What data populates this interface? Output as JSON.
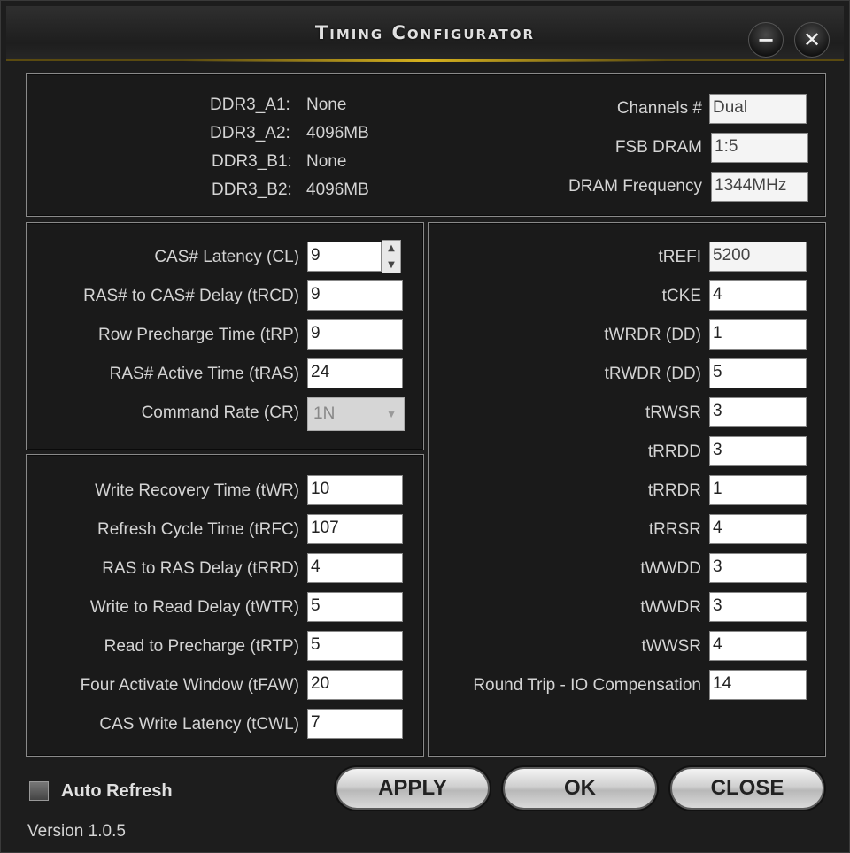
{
  "window": {
    "title": "Timing Configurator",
    "minimize": "−",
    "close": "✕"
  },
  "memory": {
    "slots": [
      {
        "label": "DDR3_A1:",
        "value": "None"
      },
      {
        "label": "DDR3_A2:",
        "value": "4096MB"
      },
      {
        "label": "DDR3_B1:",
        "value": "None"
      },
      {
        "label": "DDR3_B2:",
        "value": "4096MB"
      }
    ],
    "channels_label": "Channels #",
    "channels_value": "Dual",
    "fsb_label": "FSB DRAM",
    "fsb_value": "1:5",
    "freq_label": "DRAM Frequency",
    "freq_value": "1344MHz"
  },
  "primary": {
    "cl_label": "CAS# Latency (CL)",
    "cl_value": "9",
    "trcd_label": "RAS# to CAS# Delay (tRCD)",
    "trcd_value": "9",
    "trp_label": "Row Precharge Time (tRP)",
    "trp_value": "9",
    "tras_label": "RAS# Active Time (tRAS)",
    "tras_value": "24",
    "cr_label": "Command Rate (CR)",
    "cr_value": "1N"
  },
  "secondary": [
    {
      "label": "Write Recovery Time (tWR)",
      "value": "10"
    },
    {
      "label": "Refresh Cycle Time (tRFC)",
      "value": "107"
    },
    {
      "label": "RAS to RAS Delay (tRRD)",
      "value": "4"
    },
    {
      "label": "Write to Read Delay (tWTR)",
      "value": "5"
    },
    {
      "label": "Read to Precharge (tRTP)",
      "value": "5"
    },
    {
      "label": "Four Activate Window (tFAW)",
      "value": "20"
    },
    {
      "label": "CAS Write Latency (tCWL)",
      "value": "7"
    }
  ],
  "tertiary": [
    {
      "label": "tREFI",
      "value": "5200"
    },
    {
      "label": "tCKE",
      "value": "4"
    },
    {
      "label": "tWRDR (DD)",
      "value": "1"
    },
    {
      "label": "tRWDR (DD)",
      "value": "5"
    },
    {
      "label": "tRWSR",
      "value": "3"
    },
    {
      "label": "tRRDD",
      "value": "3"
    },
    {
      "label": "tRRDR",
      "value": "1"
    },
    {
      "label": "tRRSR",
      "value": "4"
    },
    {
      "label": "tWWDD",
      "value": "3"
    },
    {
      "label": "tWWDR",
      "value": "3"
    },
    {
      "label": "tWWSR",
      "value": "4"
    },
    {
      "label": "Round Trip - IO Compensation",
      "value": "14"
    }
  ],
  "footer": {
    "auto_refresh": "Auto Refresh",
    "apply": "APPLY",
    "ok": "OK",
    "close": "CLOSE",
    "version": "Version 1.0.5"
  }
}
